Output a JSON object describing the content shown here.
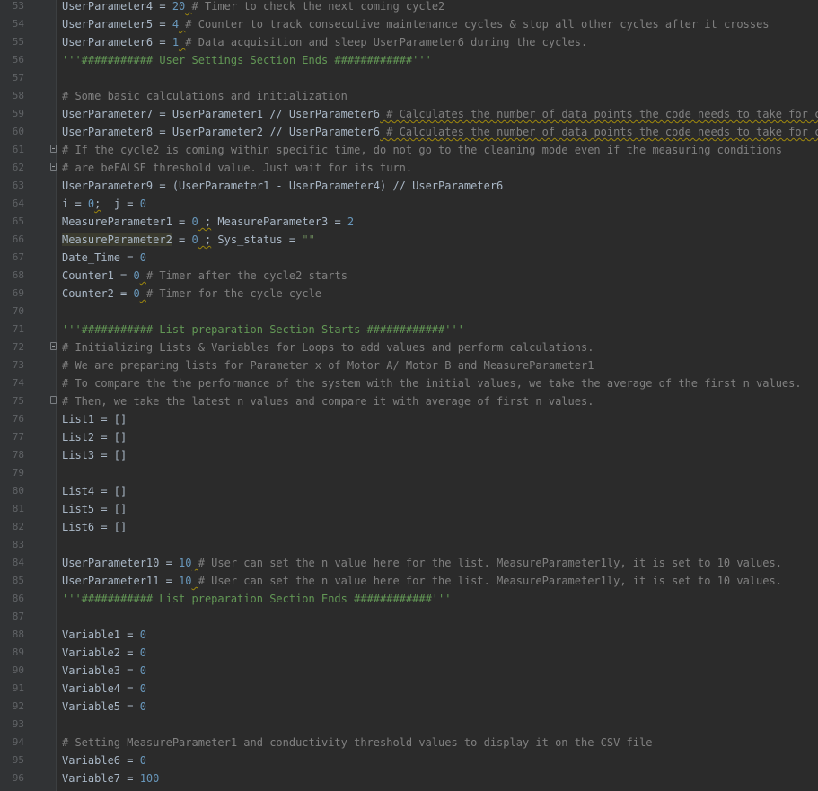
{
  "editor": {
    "colors": {
      "background": "#2b2b2b",
      "gutter": "#313335",
      "line_number": "#606366",
      "default": "#a9b7c6",
      "number": "#6897bb",
      "comment": "#808080",
      "docstring": "#629755",
      "string": "#6a8759",
      "warning_underline": "#9e880d",
      "selection_highlight": "#3b3b2f"
    },
    "lines": [
      {
        "num": "53",
        "tokens": [
          [
            "UserParameter4 = ",
            "default"
          ],
          [
            "20",
            "number"
          ],
          [
            " ",
            "warn"
          ],
          [
            "# Timer to check the next coming cycle2",
            "comment"
          ]
        ]
      },
      {
        "num": "54",
        "tokens": [
          [
            "UserParameter5 = ",
            "default"
          ],
          [
            "4",
            "number"
          ],
          [
            " ",
            "warn"
          ],
          [
            "# Counter to track consecutive maintenance cycles & stop all other cycles after it crosses",
            "comment"
          ]
        ]
      },
      {
        "num": "55",
        "tokens": [
          [
            "UserParameter6 = ",
            "default"
          ],
          [
            "1",
            "number"
          ],
          [
            " ",
            "warn"
          ],
          [
            "# Data acquisition and sleep UserParameter6 during the cycles.",
            "comment"
          ]
        ]
      },
      {
        "num": "56",
        "tokens": [
          [
            "'''########### User Settings Section Ends ############'''",
            "docstring"
          ]
        ]
      },
      {
        "num": "57",
        "tokens": []
      },
      {
        "num": "58",
        "tokens": [
          [
            "# Some basic calculations and initialization",
            "comment"
          ]
        ]
      },
      {
        "num": "59",
        "tokens": [
          [
            "UserParameter7 = UserParameter1 // UserParameter6",
            "default"
          ],
          [
            " ",
            "warn"
          ],
          [
            "# Calculates the number of data points the code needs to take for cycle",
            "comment-warn"
          ]
        ]
      },
      {
        "num": "60",
        "tokens": [
          [
            "UserParameter8 = UserParameter2 // UserParameter6",
            "default"
          ],
          [
            " ",
            "warn"
          ],
          [
            "# Calculates the number of data points the code needs to take for cycle",
            "comment-warn"
          ]
        ]
      },
      {
        "num": "61",
        "fold": true,
        "tokens": [
          [
            "# If the cycle2 is coming within specific time, do not go to the cleaning mode even if the measuring conditions",
            "comment"
          ]
        ]
      },
      {
        "num": "62",
        "fold": true,
        "tokens": [
          [
            "# are beFALSE threshold value. Just wait for its turn.",
            "comment"
          ]
        ]
      },
      {
        "num": "63",
        "tokens": [
          [
            "UserParameter9 = (UserParameter1 - UserParameter4) // UserParameter6",
            "default"
          ]
        ]
      },
      {
        "num": "64",
        "tokens": [
          [
            "i = ",
            "default"
          ],
          [
            "0",
            "number"
          ],
          [
            ";",
            "warn"
          ],
          [
            "  j = ",
            "default"
          ],
          [
            "0",
            "number"
          ]
        ]
      },
      {
        "num": "65",
        "tokens": [
          [
            "MeasureParameter1 = ",
            "default"
          ],
          [
            "0",
            "number"
          ],
          [
            " ;",
            "warn"
          ],
          [
            " MeasureParameter3 = ",
            "default"
          ],
          [
            "2",
            "number"
          ]
        ]
      },
      {
        "num": "66",
        "tokens": [
          [
            "MeasureParameter2",
            "hl"
          ],
          [
            " = ",
            "default"
          ],
          [
            "0",
            "number"
          ],
          [
            " ;",
            "warn"
          ],
          [
            " Sys_status = ",
            "default"
          ],
          [
            "\"\"",
            "string"
          ]
        ]
      },
      {
        "num": "67",
        "tokens": [
          [
            "Date_Time = ",
            "default"
          ],
          [
            "0",
            "number"
          ]
        ]
      },
      {
        "num": "68",
        "tokens": [
          [
            "Counter1 = ",
            "default"
          ],
          [
            "0",
            "number"
          ],
          [
            " ",
            "warn"
          ],
          [
            "# Timer after the cycle2 starts",
            "comment"
          ]
        ]
      },
      {
        "num": "69",
        "tokens": [
          [
            "Counter2 = ",
            "default"
          ],
          [
            "0",
            "number"
          ],
          [
            " ",
            "warn"
          ],
          [
            "# Timer for the cycle cycle",
            "comment"
          ]
        ]
      },
      {
        "num": "70",
        "tokens": []
      },
      {
        "num": "71",
        "tokens": [
          [
            "'''########### List preparation Section Starts ############'''",
            "docstring"
          ]
        ]
      },
      {
        "num": "72",
        "fold": true,
        "tokens": [
          [
            "# Initializing Lists & Variables for Loops to add values and perform calculations.",
            "comment"
          ]
        ]
      },
      {
        "num": "73",
        "tokens": [
          [
            "# We are preparing lists for Parameter x of Motor A/ Motor B and MeasureParameter1",
            "comment"
          ]
        ]
      },
      {
        "num": "74",
        "tokens": [
          [
            "# To compare the the performance of the system with the initial values, we take the average of the first n values.",
            "comment"
          ]
        ]
      },
      {
        "num": "75",
        "fold": true,
        "tokens": [
          [
            "# Then, we take the latest n values and compare it with average of first n values.",
            "comment"
          ]
        ]
      },
      {
        "num": "76",
        "tokens": [
          [
            "List1 = []",
            "default"
          ]
        ]
      },
      {
        "num": "77",
        "tokens": [
          [
            "List2 = []",
            "default"
          ]
        ]
      },
      {
        "num": "78",
        "tokens": [
          [
            "List3 = []",
            "default"
          ]
        ]
      },
      {
        "num": "79",
        "tokens": []
      },
      {
        "num": "80",
        "tokens": [
          [
            "List4 = []",
            "default"
          ]
        ]
      },
      {
        "num": "81",
        "tokens": [
          [
            "List5 = []",
            "default"
          ]
        ]
      },
      {
        "num": "82",
        "tokens": [
          [
            "List6 = []",
            "default"
          ]
        ]
      },
      {
        "num": "83",
        "tokens": []
      },
      {
        "num": "84",
        "tokens": [
          [
            "UserParameter10 = ",
            "default"
          ],
          [
            "10",
            "number"
          ],
          [
            " ",
            "warn"
          ],
          [
            "# User can set the n value here for the list. MeasureParameter1ly, it is set to 10 values.",
            "comment"
          ]
        ]
      },
      {
        "num": "85",
        "tokens": [
          [
            "UserParameter11 = ",
            "default"
          ],
          [
            "10",
            "number"
          ],
          [
            " ",
            "warn"
          ],
          [
            "# User can set the n value here for the list. MeasureParameter1ly, it is set to 10 values.",
            "comment"
          ]
        ]
      },
      {
        "num": "86",
        "tokens": [
          [
            "'''########### List preparation Section Ends ############'''",
            "docstring"
          ]
        ]
      },
      {
        "num": "87",
        "tokens": []
      },
      {
        "num": "88",
        "tokens": [
          [
            "Variable1 = ",
            "default"
          ],
          [
            "0",
            "number"
          ]
        ]
      },
      {
        "num": "89",
        "tokens": [
          [
            "Variable2 = ",
            "default"
          ],
          [
            "0",
            "number"
          ]
        ]
      },
      {
        "num": "90",
        "tokens": [
          [
            "Variable3 = ",
            "default"
          ],
          [
            "0",
            "number"
          ]
        ]
      },
      {
        "num": "91",
        "tokens": [
          [
            "Variable4 = ",
            "default"
          ],
          [
            "0",
            "number"
          ]
        ]
      },
      {
        "num": "92",
        "tokens": [
          [
            "Variable5 = ",
            "default"
          ],
          [
            "0",
            "number"
          ]
        ]
      },
      {
        "num": "93",
        "tokens": []
      },
      {
        "num": "94",
        "tokens": [
          [
            "# Setting MeasureParameter1 and conductivity threshold values to display it on the CSV file",
            "comment"
          ]
        ]
      },
      {
        "num": "95",
        "tokens": [
          [
            "Variable6 = ",
            "default"
          ],
          [
            "0",
            "number"
          ]
        ]
      },
      {
        "num": "96",
        "tokens": [
          [
            "Variable7 = ",
            "default"
          ],
          [
            "100",
            "number"
          ]
        ]
      }
    ]
  }
}
